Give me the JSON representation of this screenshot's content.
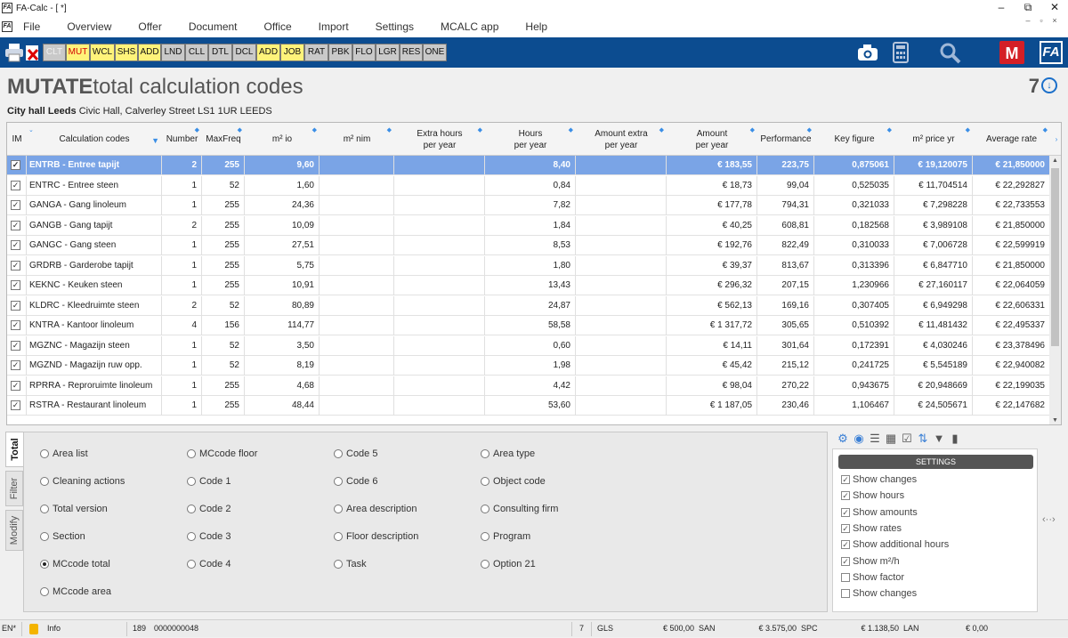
{
  "window": {
    "title": "FA-Calc - [ *]",
    "app_icon": "FA"
  },
  "menu": [
    "File",
    "Overview",
    "Offer",
    "Document",
    "Office",
    "Import",
    "Settings",
    "MCALC app",
    "Help"
  ],
  "toolbar": {
    "buttons": [
      "CLT",
      "MUT",
      "WCL",
      "SHS",
      "ADD",
      "LND",
      "CLL",
      "DTL",
      "DCL",
      "ADD",
      "JOB",
      "RAT",
      "PBK",
      "FLO",
      "LGR",
      "RES",
      "ONE"
    ],
    "right_logo": "FA"
  },
  "header": {
    "title_bold": "MUTATE",
    "title_rest": "total calculation codes",
    "count": "7"
  },
  "location": {
    "name": "City hall Leeds",
    "address": "Civic Hall, Calverley Street LS1 1UR LEEDS"
  },
  "columns": {
    "im": "IM",
    "code": "Calculation codes",
    "number": "Number",
    "maxfreq": "MaxFreq",
    "m2io": "m² io",
    "m2nim": "m² nim",
    "extra1": "Extra hours",
    "extra2": "per year",
    "hours1": "Hours",
    "hours2": "per year",
    "amtx1": "Amount extra",
    "amtx2": "per year",
    "amt1": "Amount",
    "amt2": "per year",
    "perf": "Performance",
    "key": "Key figure",
    "m2price": "m² price yr",
    "avg": "Average rate"
  },
  "rows": [
    {
      "code": "ENTRB - Entree tapijt",
      "number": "2",
      "maxfreq": "255",
      "m2io": "9,60",
      "hours": "8,40",
      "amount": "€ 183,55",
      "performance": "223,75",
      "key": "0,875061",
      "m2price": "€ 19,120075",
      "avg": "€ 21,850000"
    },
    {
      "code": "ENTRC - Entree steen",
      "number": "1",
      "maxfreq": "52",
      "m2io": "1,60",
      "hours": "0,84",
      "amount": "€ 18,73",
      "performance": "99,04",
      "key": "0,525035",
      "m2price": "€ 11,704514",
      "avg": "€ 22,292827"
    },
    {
      "code": "GANGA - Gang linoleum",
      "number": "1",
      "maxfreq": "255",
      "m2io": "24,36",
      "hours": "7,82",
      "amount": "€ 177,78",
      "performance": "794,31",
      "key": "0,321033",
      "m2price": "€ 7,298228",
      "avg": "€ 22,733553"
    },
    {
      "code": "GANGB - Gang tapijt",
      "number": "2",
      "maxfreq": "255",
      "m2io": "10,09",
      "hours": "1,84",
      "amount": "€ 40,25",
      "performance": "608,81",
      "key": "0,182568",
      "m2price": "€ 3,989108",
      "avg": "€ 21,850000"
    },
    {
      "code": "GANGC - Gang steen",
      "number": "1",
      "maxfreq": "255",
      "m2io": "27,51",
      "hours": "8,53",
      "amount": "€ 192,76",
      "performance": "822,49",
      "key": "0,310033",
      "m2price": "€ 7,006728",
      "avg": "€ 22,599919"
    },
    {
      "code": "GRDRB - Garderobe tapijt",
      "number": "1",
      "maxfreq": "255",
      "m2io": "5,75",
      "hours": "1,80",
      "amount": "€ 39,37",
      "performance": "813,67",
      "key": "0,313396",
      "m2price": "€ 6,847710",
      "avg": "€ 21,850000"
    },
    {
      "code": "KEKNC - Keuken steen",
      "number": "1",
      "maxfreq": "255",
      "m2io": "10,91",
      "hours": "13,43",
      "amount": "€ 296,32",
      "performance": "207,15",
      "key": "1,230966",
      "m2price": "€ 27,160117",
      "avg": "€ 22,064059"
    },
    {
      "code": "KLDRC - Kleedruimte steen",
      "number": "2",
      "maxfreq": "52",
      "m2io": "80,89",
      "hours": "24,87",
      "amount": "€ 562,13",
      "performance": "169,16",
      "key": "0,307405",
      "m2price": "€ 6,949298",
      "avg": "€ 22,606331"
    },
    {
      "code": "KNTRA - Kantoor linoleum",
      "number": "4",
      "maxfreq": "156",
      "m2io": "114,77",
      "hours": "58,58",
      "amount": "€ 1 317,72",
      "performance": "305,65",
      "key": "0,510392",
      "m2price": "€ 11,481432",
      "avg": "€ 22,495337"
    },
    {
      "code": "MGZNC - Magazijn steen",
      "number": "1",
      "maxfreq": "52",
      "m2io": "3,50",
      "hours": "0,60",
      "amount": "€ 14,11",
      "performance": "301,64",
      "key": "0,172391",
      "m2price": "€ 4,030246",
      "avg": "€ 23,378496"
    },
    {
      "code": "MGZND - Magazijn ruw opp.",
      "number": "1",
      "maxfreq": "52",
      "m2io": "8,19",
      "hours": "1,98",
      "amount": "€ 45,42",
      "performance": "215,12",
      "key": "0,241725",
      "m2price": "€ 5,545189",
      "avg": "€ 22,940082"
    },
    {
      "code": "RPRRA - Reproruimte linoleum",
      "number": "1",
      "maxfreq": "255",
      "m2io": "4,68",
      "hours": "4,42",
      "amount": "€ 98,04",
      "performance": "270,22",
      "key": "0,943675",
      "m2price": "€ 20,948669",
      "avg": "€ 22,199035"
    },
    {
      "code": "RSTRA - Restaurant linoleum",
      "number": "1",
      "maxfreq": "255",
      "m2io": "48,44",
      "hours": "53,60",
      "amount": "€ 1 187,05",
      "performance": "230,46",
      "key": "1,106467",
      "m2price": "€ 24,505671",
      "avg": "€ 22,147682"
    }
  ],
  "side_tabs": [
    "Total",
    "Filter",
    "Modify"
  ],
  "options": [
    [
      "Area list",
      "Cleaning actions",
      "Total version",
      "Section",
      "MCcode total",
      "MCcode area"
    ],
    [
      "MCcode floor",
      "Code 1",
      "Code 2",
      "Code 3",
      "Code 4"
    ],
    [
      "Code 5",
      "Code 6",
      "Area description",
      "Floor description",
      "Task"
    ],
    [
      "Area type",
      "Object code",
      "Consulting firm",
      "Program",
      "Option 21"
    ]
  ],
  "selected_option": "MCcode total",
  "settings": {
    "header": "SETTINGS",
    "items": [
      {
        "label": "Show changes",
        "checked": true
      },
      {
        "label": "Show hours",
        "checked": true
      },
      {
        "label": "Show amounts",
        "checked": true
      },
      {
        "label": "Show rates",
        "checked": true
      },
      {
        "label": "Show additional hours",
        "checked": true
      },
      {
        "label": "Show m²/h",
        "checked": true
      },
      {
        "label": "Show factor",
        "checked": false
      },
      {
        "label": "Show changes",
        "checked": false
      }
    ]
  },
  "status": {
    "lang": "EN*",
    "info": "Info",
    "num": "189",
    "code": "0000000048",
    "count": "7",
    "gls_label": "GLS",
    "gls": "€ 500,00",
    "san_label": "SAN",
    "san": "€ 3.575,00",
    "spc_label": "SPC",
    "spc": "€ 1.138,50",
    "lan_label": "LAN",
    "lan": "€ 0,00"
  },
  "colors": {
    "toolbar": "#0c4c90",
    "selected_row": "#7aa4e6",
    "accent": "#d41f26"
  }
}
